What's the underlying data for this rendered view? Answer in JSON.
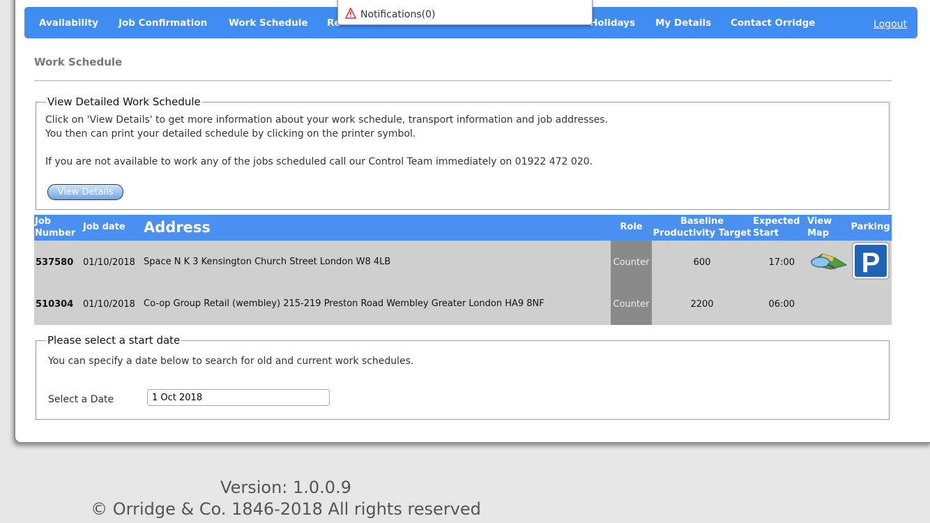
{
  "nav": {
    "items": [
      "Availability",
      "Job Confirmation",
      "Work Schedule",
      "Re",
      "Holidays",
      "My Details",
      "Contact Orridge"
    ],
    "logout": "Logout"
  },
  "notifications": {
    "label": "Notifications(0)"
  },
  "page": {
    "title": "Work Schedule"
  },
  "detail": {
    "legend": "View Detailed Work Schedule",
    "line1": "Click on 'View Details' to get more information about your work schedule, transport information and job addresses.",
    "line2": "You then can print your detailed schedule by clicking on the printer symbol.",
    "line3": "If you are not available to work any of the jobs scheduled call our Control Team immediately on 01922 472 020.",
    "button": "View Details"
  },
  "table": {
    "headers": {
      "job_number": "Job Number",
      "job_date": "Job date",
      "address": "Address",
      "role": "Role",
      "baseline": "Baseline Productivity Target",
      "expected": "Expected Start",
      "view_map": "View Map",
      "parking": "Parking"
    },
    "rows": [
      {
        "job_number": "537580",
        "job_date": "01/10/2018",
        "address": "Space N K 3 Kensington Church Street London W8 4LB",
        "role": "Counter",
        "baseline": "600",
        "expected": "17:00",
        "has_map": true,
        "has_parking": true
      },
      {
        "job_number": "510304",
        "job_date": "01/10/2018",
        "address": "Co-op Group Retail (wembley) 215-219 Preston Road Wembley Greater London HA9 8NF",
        "role": "Counter",
        "baseline": "2200",
        "expected": "06:00",
        "has_map": false,
        "has_parking": false
      }
    ]
  },
  "date_select": {
    "legend": "Please select a start date",
    "info": "You can specify a date below to search for old and current work schedules.",
    "label": "Select a Date",
    "value": "1 Oct 2018"
  },
  "footer": {
    "version": "Version: 1.0.0.9",
    "copyright": "© Orridge & Co. 1846-2018 All rights reserved"
  },
  "colors": {
    "nav": "#3f8cf2",
    "address_link": "#3b8df3",
    "parking_blue": "#1f63b8"
  },
  "icons": {
    "map": "map-icon",
    "parking": "parking-icon",
    "warning": "warning-icon"
  }
}
